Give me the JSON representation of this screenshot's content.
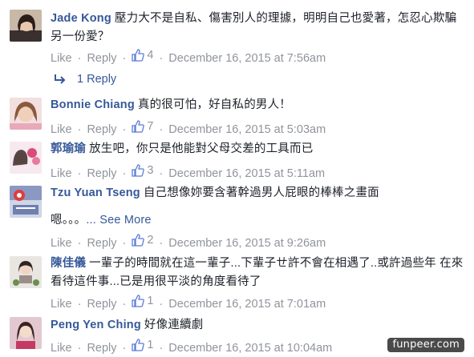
{
  "actions": {
    "like": "Like",
    "reply": "Reply",
    "dot": "·"
  },
  "comments": [
    {
      "author": "Jade Kong",
      "text": "壓力大不是自私、傷害別人的理據，明明自己也愛著，怎忍心欺騙另一份愛？",
      "likes": "4",
      "time": "December 16, 2015 at 7:56am",
      "replies_label": "1 Reply"
    },
    {
      "author": "Bonnie Chiang",
      "text": "真的很可怕，好自私的男人！",
      "likes": "7",
      "time": "December 16, 2015 at 5:03am"
    },
    {
      "author": "郭瑜瑜",
      "text": "放生吧，你只是他能對父母交差的工具而已",
      "likes": "3",
      "time": "December 16, 2015 at 5:11am"
    },
    {
      "author": "Tzu Yuan Tseng",
      "text": "自己想像妳要含著幹過男人屁眼的棒棒之畫面",
      "text2": "嗯。。。",
      "see_more": "... See More",
      "likes": "2",
      "time": "December 16, 2015 at 9:26am"
    },
    {
      "author": "陳佳儀",
      "text": "一輩子的時間就在這一輩子...下輩子ㄝ許不會在相遇了..或許過些年 在來看待這件事...已是用很平淡的角度看待了",
      "likes": "1",
      "time": "December 16, 2015 at 7:01am"
    },
    {
      "author": "Peng Yen Ching",
      "text": "好像連續劇",
      "likes": "1",
      "time": "December 16, 2015 at 10:04am"
    }
  ],
  "watermark": "funpeer.com",
  "colors": {
    "link": "#365899",
    "meta": "#90949c",
    "text": "#1d2129"
  }
}
